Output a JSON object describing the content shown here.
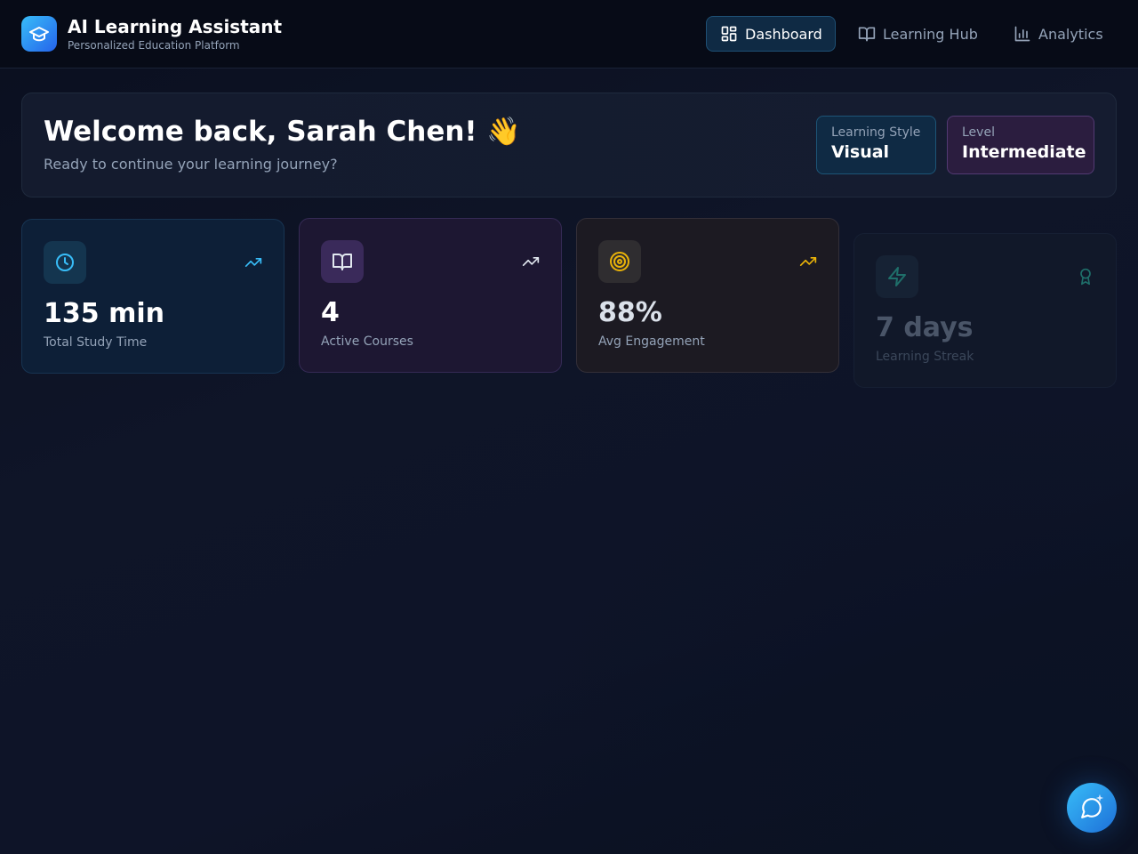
{
  "header": {
    "title": "AI Learning Assistant",
    "subtitle": "Personalized Education Platform",
    "logo_icon": "graduation-cap-icon",
    "nav": [
      {
        "label": "Dashboard",
        "icon": "dashboard-grid-icon",
        "active": true
      },
      {
        "label": "Learning Hub",
        "icon": "book-open-icon",
        "active": false
      },
      {
        "label": "Analytics",
        "icon": "bar-chart-icon",
        "active": false
      }
    ]
  },
  "welcome": {
    "title": "Welcome back, Sarah Chen! 👋",
    "subtitle": "Ready to continue your learning journey?",
    "learning_style": {
      "label": "Learning Style",
      "value": "Visual"
    },
    "level": {
      "label": "Level",
      "value": "Intermediate"
    }
  },
  "stats": [
    {
      "value": "135 min",
      "label": "Total Study Time",
      "icon": "clock-icon",
      "trend_icon": "trending-up-icon",
      "color": "#38bdf8"
    },
    {
      "value": "4",
      "label": "Active Courses",
      "icon": "book-open-icon",
      "trend_icon": "trending-up-icon",
      "color": "#e2e8f0"
    },
    {
      "value": "88%",
      "label": "Avg Engagement",
      "icon": "target-icon",
      "trend_icon": "trending-up-icon",
      "color": "#eab308"
    },
    {
      "value": "7 days",
      "label": "Learning Streak",
      "icon": "lightning-icon",
      "trend_icon": "award-icon",
      "color": "#14b8a6"
    }
  ],
  "chat": {
    "icon": "chat-bubble-icon"
  },
  "colors": {
    "accent": "#38bdf8",
    "header_bg": "#070b17",
    "page_bg": "#0f1528"
  }
}
